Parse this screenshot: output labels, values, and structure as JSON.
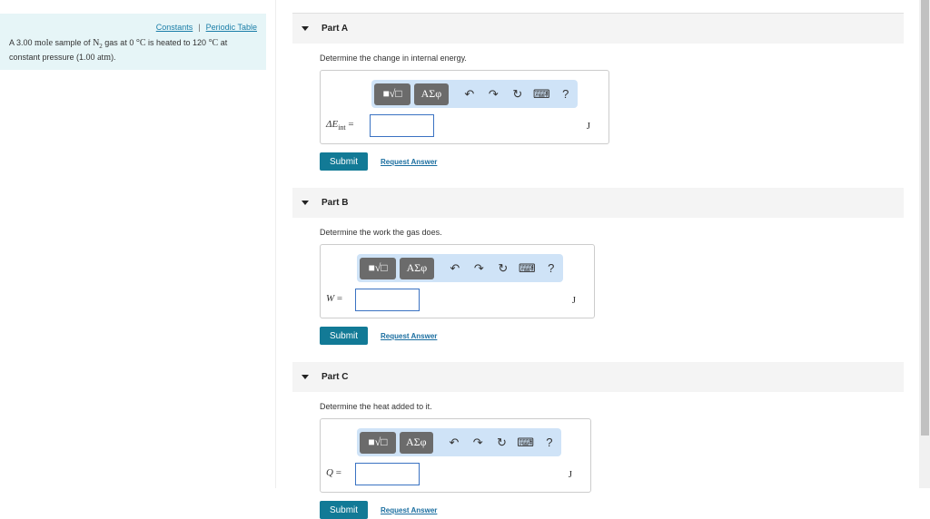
{
  "sidebar": {
    "links": [
      "Constants",
      "Periodic Table"
    ],
    "separator": "|",
    "problem": {
      "t1": "A 3.00 ",
      "mole": "mole",
      "t2": " sample of ",
      "n2": "N",
      "sub": "2",
      "t3": " gas at 0 ",
      "deg1": "°C",
      "t4": " is heated to 120 ",
      "deg2": "°C",
      "t5": " at constant pressure (1.00 ",
      "atm": "atm",
      "t6": ")."
    }
  },
  "toolbar": {
    "templates": "■√□",
    "greek": "ΑΣφ",
    "undo": "↶",
    "redo": "↷",
    "reset": "↻",
    "keyboard": "⌨",
    "help": "?"
  },
  "submit": "Submit",
  "request": "Request Answer",
  "parts": [
    {
      "title": "Part A",
      "prompt": "Determine the change in internal energy.",
      "label": "ΔE",
      "label_sub": "int",
      "eq": " =",
      "value": "",
      "unit": "J"
    },
    {
      "title": "Part B",
      "prompt": "Determine the work the gas does.",
      "label": "W",
      "label_sub": "",
      "eq": " =",
      "value": "",
      "unit": "J"
    },
    {
      "title": "Part C",
      "prompt": "Determine the heat added to it.",
      "label": "Q",
      "label_sub": "",
      "eq": " =",
      "value": "",
      "unit": "J"
    }
  ]
}
